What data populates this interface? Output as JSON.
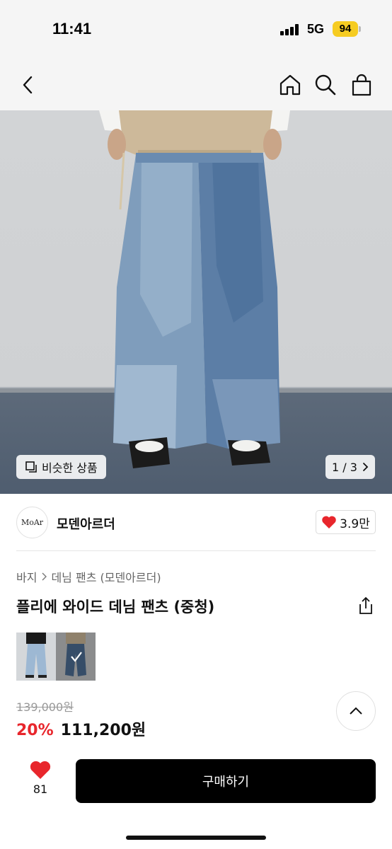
{
  "status": {
    "time": "11:41",
    "network": "5G",
    "battery": "94"
  },
  "nav": {
    "back_icon": "chevron-left-icon",
    "home_icon": "home-icon",
    "search_icon": "search-icon",
    "bag_icon": "bag-icon"
  },
  "gallery": {
    "similar_label": "비슷한 상품",
    "counter": "1 / 3"
  },
  "brand": {
    "logo_text": "MoAr",
    "name": "모덴아르더",
    "likes": "3.9만"
  },
  "breadcrumb": {
    "category": "바지",
    "subcategory": "데님 팬츠 (모덴아르더)"
  },
  "product": {
    "title": "플리에 와이드 데님 팬츠 (중청)",
    "original_price": "139,000원",
    "discount": "20%",
    "price": "111,200원"
  },
  "bottom": {
    "like_count": "81",
    "buy_label": "구매하기"
  },
  "colors": {
    "accent_red": "#e8262c",
    "heart": "#e8262c",
    "buy_bg": "#000000",
    "battery": "#f6cc22"
  }
}
